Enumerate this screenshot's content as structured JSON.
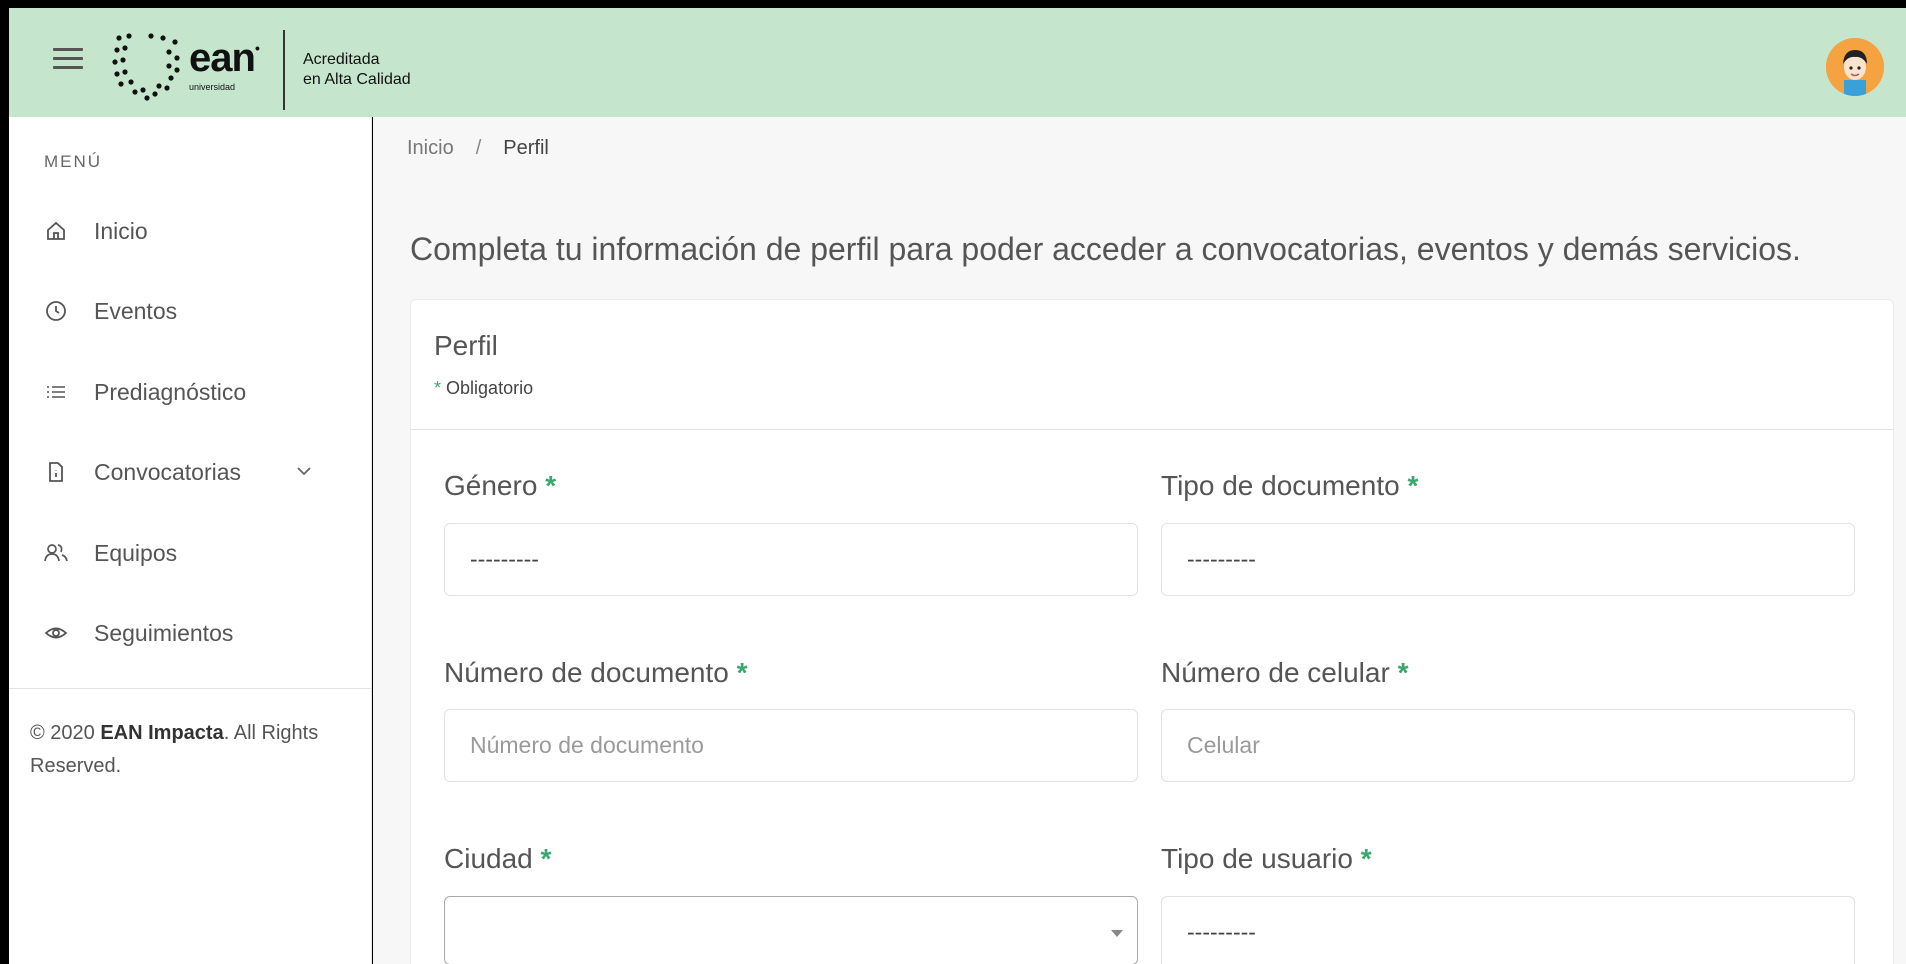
{
  "header": {
    "logo_text": "ean",
    "logo_sub": "universidad",
    "accreditation_line1": "Acreditada",
    "accreditation_line2": "en Alta Calidad",
    "brand_color": "#c5e6cc"
  },
  "sidebar": {
    "menu_title": "MENÚ",
    "items": [
      {
        "label": "Inicio",
        "icon": "home-icon"
      },
      {
        "label": "Eventos",
        "icon": "clock-icon"
      },
      {
        "label": "Prediagnóstico",
        "icon": "list-icon"
      },
      {
        "label": "Convocatorias",
        "icon": "document-icon",
        "has_submenu": true
      },
      {
        "label": "Equipos",
        "icon": "users-icon"
      },
      {
        "label": "Seguimientos",
        "icon": "eye-icon"
      }
    ],
    "copyright_prefix": "© 2020 ",
    "copyright_brand": "EAN Impacta",
    "copyright_suffix": ". All Rights Reserved."
  },
  "breadcrumb": {
    "home": "Inicio",
    "separator": "/",
    "current": "Perfil"
  },
  "main": {
    "intro_text": "Completa tu información de perfil para poder acceder a convocatorias, eventos y demás servicios."
  },
  "form": {
    "title": "Perfil",
    "required_mark": "*",
    "required_note": "Obligatorio",
    "accent_color": "#3aa76d",
    "fields": {
      "genero": {
        "label": "Género",
        "value": "---------"
      },
      "tipo_documento": {
        "label": "Tipo de documento",
        "value": "---------"
      },
      "numero_documento": {
        "label": "Número de documento",
        "placeholder": "Número de documento"
      },
      "numero_celular": {
        "label": "Número de celular",
        "placeholder": "Celular"
      },
      "ciudad": {
        "label": "Ciudad",
        "value": ""
      },
      "tipo_usuario": {
        "label": "Tipo de usuario",
        "value": "---------"
      }
    }
  }
}
